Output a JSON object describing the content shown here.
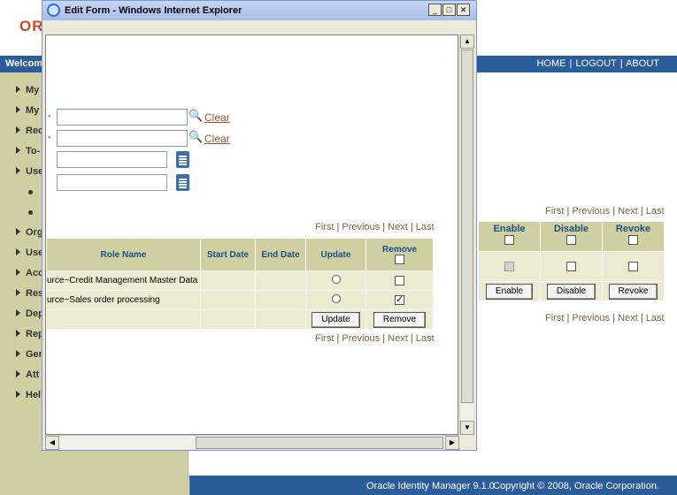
{
  "background": {
    "logo_text": "OR",
    "welcome_text": "Welcom",
    "nav": {
      "home": "HOME",
      "logout": "LOGOUT",
      "about": "ABOUT"
    },
    "left_menu": [
      {
        "label": "My",
        "type": "arrow"
      },
      {
        "label": "My",
        "type": "arrow"
      },
      {
        "label": "Rec",
        "type": "arrow"
      },
      {
        "label": "To-",
        "type": "arrow"
      },
      {
        "label": "Use",
        "type": "arrow"
      },
      {
        "label": "",
        "type": "bullet"
      },
      {
        "label": "",
        "type": "bullet"
      },
      {
        "label": "Org",
        "type": "arrow"
      },
      {
        "label": "Use",
        "type": "arrow"
      },
      {
        "label": "Acc",
        "type": "arrow"
      },
      {
        "label": "Res",
        "type": "arrow"
      },
      {
        "label": "Dep",
        "type": "arrow"
      },
      {
        "label": "Rep",
        "type": "arrow"
      },
      {
        "label": "Gen",
        "type": "arrow"
      },
      {
        "label": "Att",
        "type": "arrow"
      },
      {
        "label": "Hel",
        "type": "arrow"
      }
    ],
    "pager": {
      "first": "First",
      "previous": "Previous",
      "next": "Next",
      "last": "Last"
    },
    "columns": {
      "enable": "Enable",
      "disable": "Disable",
      "revoke": "Revoke"
    },
    "buttons": {
      "enable": "Enable",
      "disable": "Disable",
      "revoke": "Revoke"
    },
    "footer": {
      "version": "Oracle Identity Manager 9.1.0",
      "copyright": "Copyright © 2008, Oracle Corporation."
    }
  },
  "popup": {
    "title": "Edit Form - Windows Internet Explorer",
    "fields": {
      "field1": {
        "value": "",
        "required": true,
        "clear_label": "Clear"
      },
      "field2": {
        "value": "",
        "required": true,
        "clear_label": "Clear"
      },
      "date1": {
        "value": ""
      },
      "date2": {
        "value": ""
      }
    },
    "pager": {
      "first": "First",
      "previous": "Previous",
      "next": "Next",
      "last": "Last"
    },
    "grid": {
      "columns": {
        "role_name": "Role Name",
        "start_date": "Start Date",
        "end_date": "End Date",
        "update": "Update",
        "remove": "Remove"
      },
      "rows": [
        {
          "role_name": "urce~Credit Management Master Data",
          "start_date": "",
          "end_date": "",
          "update_selected": false,
          "remove_checked": false
        },
        {
          "role_name": "urce~Sales order processing",
          "start_date": "",
          "end_date": "",
          "update_selected": false,
          "remove_checked": true
        }
      ],
      "buttons": {
        "update": "Update",
        "remove": "Remove"
      }
    }
  }
}
